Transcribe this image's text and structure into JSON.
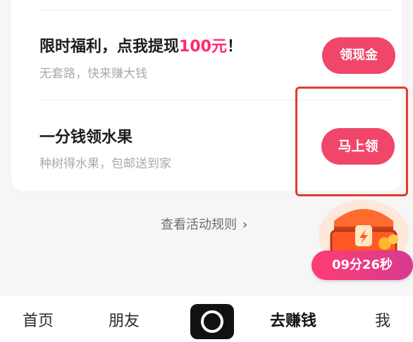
{
  "tasks": [
    {
      "title_prefix": "限时福利，点我提现",
      "title_highlight": "100元",
      "title_suffix": "！",
      "subtitle": "无套路，快来赚大钱",
      "button": "领现金"
    },
    {
      "title": "一分钱领水果",
      "subtitle": "种树得水果，包邮送到家",
      "button": "马上领"
    }
  ],
  "rules_link": "查看活动规则",
  "timer": "09分26秒",
  "tabs": {
    "home": "首页",
    "friends": "朋友",
    "earn": "去赚钱",
    "me": "我"
  },
  "colors": {
    "accent": "#f0466a",
    "highlight_text": "#ff2b6a",
    "annotation_box": "#e63a2e"
  }
}
